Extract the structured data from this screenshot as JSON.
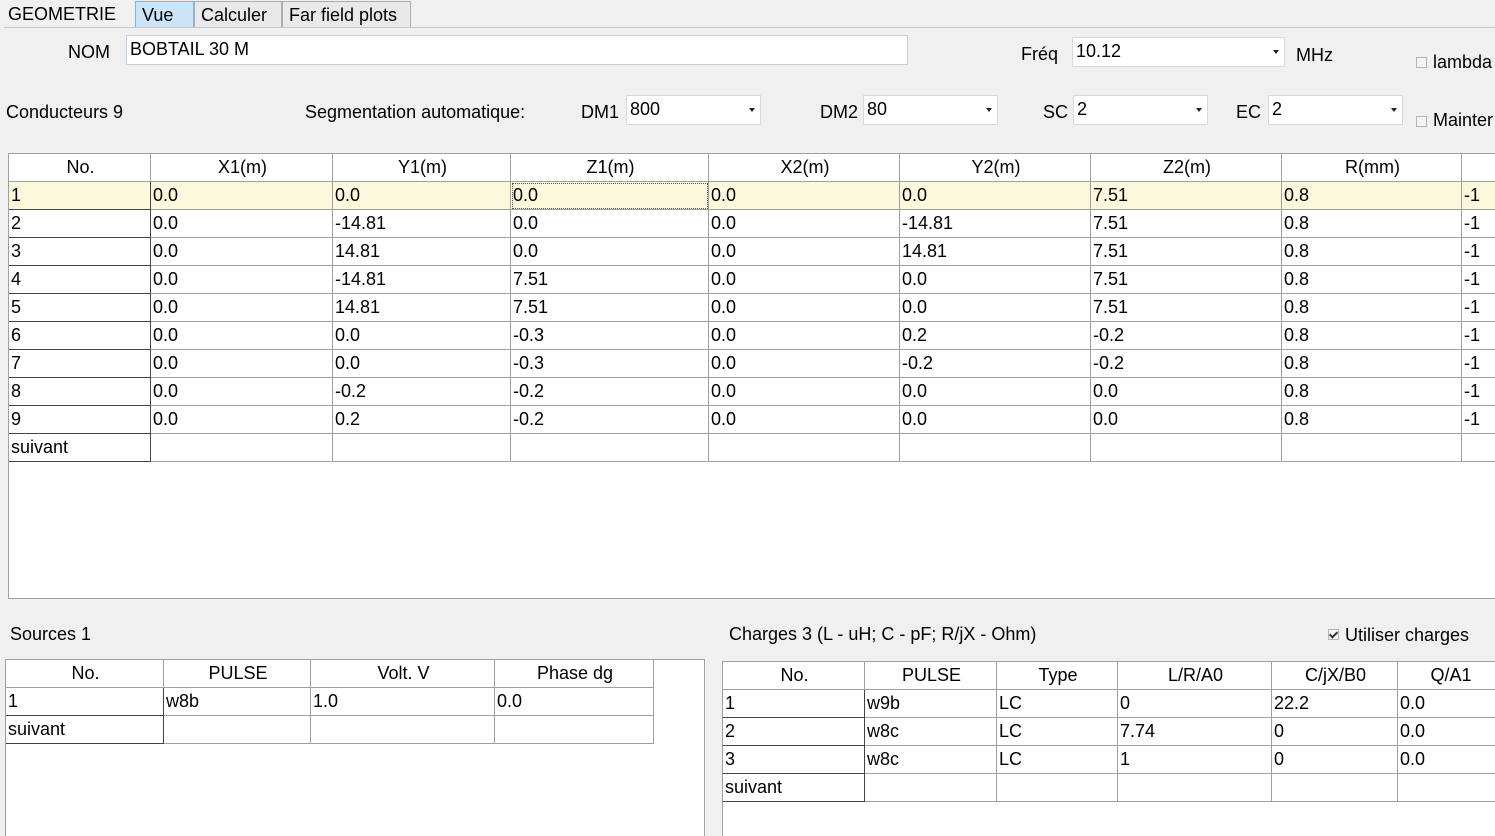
{
  "tabs": [
    "GEOMETRIE",
    "Vue",
    "Calculer",
    "Far field plots"
  ],
  "nom": {
    "label": "NOM",
    "value": "BOBTAIL 30 M"
  },
  "freq": {
    "label": "Fréq",
    "value": "10.12",
    "unit": "MHz"
  },
  "lambda_label": "lambda",
  "conducteurs_label": "Conducteurs 9",
  "segmentation_label": "Segmentation automatique:",
  "dm1": {
    "label": "DM1",
    "value": "800"
  },
  "dm2": {
    "label": "DM2",
    "value": "80"
  },
  "sc": {
    "label": "SC",
    "value": "2"
  },
  "ec": {
    "label": "EC",
    "value": "2"
  },
  "maintenir_label": "Mainter",
  "wires": {
    "headers": [
      "No.",
      "X1(m)",
      "Y1(m)",
      "Z1(m)",
      "X2(m)",
      "Y2(m)",
      "Z2(m)",
      "R(mm)",
      ""
    ],
    "rows": [
      [
        "1",
        "0.0",
        "0.0",
        "0.0",
        "0.0",
        "0.0",
        "7.51",
        "0.8",
        "-1"
      ],
      [
        "2",
        "0.0",
        "-14.81",
        "0.0",
        "0.0",
        "-14.81",
        "7.51",
        "0.8",
        "-1"
      ],
      [
        "3",
        "0.0",
        "14.81",
        "0.0",
        "0.0",
        "14.81",
        "7.51",
        "0.8",
        "-1"
      ],
      [
        "4",
        "0.0",
        "-14.81",
        "7.51",
        "0.0",
        "0.0",
        "7.51",
        "0.8",
        "-1"
      ],
      [
        "5",
        "0.0",
        "14.81",
        "7.51",
        "0.0",
        "0.0",
        "7.51",
        "0.8",
        "-1"
      ],
      [
        "6",
        "0.0",
        "0.0",
        "-0.3",
        "0.0",
        "0.2",
        "-0.2",
        "0.8",
        "-1"
      ],
      [
        "7",
        "0.0",
        "0.0",
        "-0.3",
        "0.0",
        "-0.2",
        "-0.2",
        "0.8",
        "-1"
      ],
      [
        "8",
        "0.0",
        "-0.2",
        "-0.2",
        "0.0",
        "0.0",
        "0.0",
        "0.8",
        "-1"
      ],
      [
        "9",
        "0.0",
        "0.2",
        "-0.2",
        "0.0",
        "0.0",
        "0.0",
        "0.8",
        "-1"
      ]
    ],
    "next_label": "suivant"
  },
  "sources": {
    "label": "Sources 1",
    "headers": [
      "No.",
      "PULSE",
      "Volt. V",
      "Phase dg"
    ],
    "rows": [
      [
        "1",
        "w8b",
        "1.0",
        "0.0"
      ]
    ],
    "next_label": "suivant"
  },
  "charges": {
    "label": "Charges 3 (L - uH; C - pF; R/jX - Ohm)",
    "use_label": "Utiliser charges",
    "use_checked": true,
    "headers": [
      "No.",
      "PULSE",
      "Type",
      "L/R/A0",
      "C/jX/B0",
      "Q/A1"
    ],
    "rows": [
      [
        "1",
        "w9b",
        "LC",
        "0",
        "22.2",
        "0.0"
      ],
      [
        "2",
        "w8c",
        "LC",
        "7.74",
        "0",
        "0.0"
      ],
      [
        "3",
        "w8c",
        "LC",
        "1",
        "0",
        "0.0"
      ]
    ],
    "next_label": "suivant"
  }
}
